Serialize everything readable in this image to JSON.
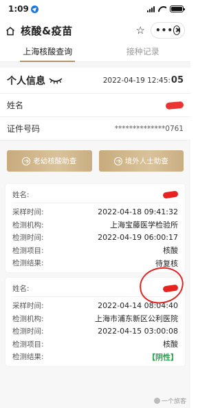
{
  "status_bar": {
    "time": "1:09"
  },
  "nav": {
    "title": "核酸&疫苗"
  },
  "tabs": [
    {
      "label": "上海核酸查询",
      "active": true
    },
    {
      "label": "接种记录",
      "active": false
    }
  ],
  "personal_info": {
    "title": "个人信息",
    "time_prefix": "2022-04-19 12:45:",
    "time_seconds": "05",
    "rows": [
      {
        "label": "姓名",
        "value": ""
      },
      {
        "label": "证件号码",
        "value": "**************0761"
      }
    ]
  },
  "buttons": [
    {
      "label": "老幼核酸助查"
    },
    {
      "label": "境外人士助查"
    }
  ],
  "records": [
    {
      "lines": [
        {
          "label": "姓名:",
          "value": ""
        },
        {
          "label": "采样时间:",
          "value": "2022-04-18 09:41:32"
        },
        {
          "label": "检测机构:",
          "value": "上海宝藤医学检验所"
        },
        {
          "label": "检测时间:",
          "value": "2022-04-19 06:00:17"
        },
        {
          "label": "检测项目:",
          "value": "核酸"
        },
        {
          "label": "检测结果:",
          "value": "待复核"
        }
      ]
    },
    {
      "lines": [
        {
          "label": "姓名:",
          "value": ""
        },
        {
          "label": "采样时间:",
          "value": "2022-04-14 08:04:40"
        },
        {
          "label": "检测机构:",
          "value": "上海市浦东新区公利医院"
        },
        {
          "label": "检测时间:",
          "value": "2022-04-15 03:00:08"
        },
        {
          "label": "检测项目:",
          "value": "核酸"
        },
        {
          "label": "检测结果:",
          "value": "【阴性】"
        }
      ]
    }
  ],
  "watermark": {
    "text": "一个旅客"
  },
  "colors": {
    "gold": "#c9ae82",
    "green": "#26a64d",
    "annotation_red": "#e32322"
  }
}
